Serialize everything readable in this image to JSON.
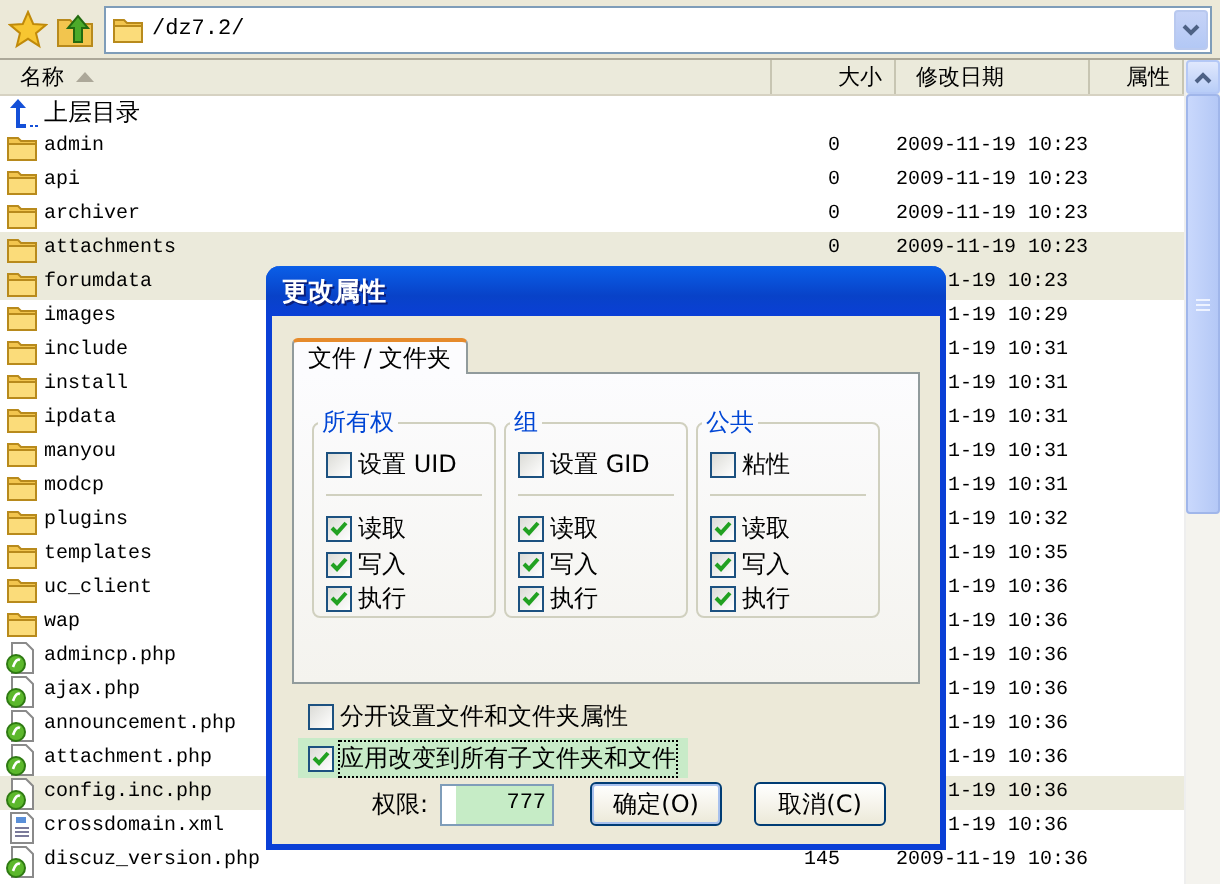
{
  "address": {
    "path": "/dz7.2/"
  },
  "columns": [
    {
      "label": "名称",
      "sorted": true
    },
    {
      "label": "大小",
      "sorted": false
    },
    {
      "label": "修改日期",
      "sorted": false
    },
    {
      "label": "属性",
      "sorted": false
    }
  ],
  "rows": [
    {
      "kind": "up",
      "name": "上层目录",
      "size": "",
      "date": "",
      "selected": false
    },
    {
      "kind": "folder",
      "name": "admin",
      "size": "0",
      "date": "2009-11-19 10:23",
      "selected": false
    },
    {
      "kind": "folder",
      "name": "api",
      "size": "0",
      "date": "2009-11-19 10:23",
      "selected": false
    },
    {
      "kind": "folder",
      "name": "archiver",
      "size": "0",
      "date": "2009-11-19 10:23",
      "selected": false
    },
    {
      "kind": "folder",
      "name": "attachments",
      "size": "0",
      "date": "2009-11-19 10:23",
      "selected": true
    },
    {
      "kind": "folder",
      "name": "forumdata",
      "size": "",
      "date": "1-19 10:23",
      "selected": true
    },
    {
      "kind": "folder",
      "name": "images",
      "size": "",
      "date": "1-19 10:29",
      "selected": false
    },
    {
      "kind": "folder",
      "name": "include",
      "size": "",
      "date": "1-19 10:31",
      "selected": false
    },
    {
      "kind": "folder",
      "name": "install",
      "size": "",
      "date": "1-19 10:31",
      "selected": false
    },
    {
      "kind": "folder",
      "name": "ipdata",
      "size": "",
      "date": "1-19 10:31",
      "selected": false
    },
    {
      "kind": "folder",
      "name": "manyou",
      "size": "",
      "date": "1-19 10:31",
      "selected": false
    },
    {
      "kind": "folder",
      "name": "modcp",
      "size": "",
      "date": "1-19 10:31",
      "selected": false
    },
    {
      "kind": "folder",
      "name": "plugins",
      "size": "",
      "date": "1-19 10:32",
      "selected": false
    },
    {
      "kind": "folder",
      "name": "templates",
      "size": "",
      "date": "1-19 10:35",
      "selected": false
    },
    {
      "kind": "folder",
      "name": "uc_client",
      "size": "",
      "date": "1-19 10:36",
      "selected": false
    },
    {
      "kind": "folder",
      "name": "wap",
      "size": "",
      "date": "1-19 10:36",
      "selected": false
    },
    {
      "kind": "php",
      "name": "admincp.php",
      "size": "",
      "date": "1-19 10:36",
      "selected": false
    },
    {
      "kind": "php",
      "name": "ajax.php",
      "size": "",
      "date": "1-19 10:36",
      "selected": false
    },
    {
      "kind": "php",
      "name": "announcement.php",
      "size": "",
      "date": "1-19 10:36",
      "selected": false
    },
    {
      "kind": "php",
      "name": "attachment.php",
      "size": "",
      "date": "1-19 10:36",
      "selected": false
    },
    {
      "kind": "php",
      "name": "config.inc.php",
      "size": "",
      "date": "1-19 10:36",
      "selected": true
    },
    {
      "kind": "xml",
      "name": "crossdomain.xml",
      "size": "",
      "date": "1-19 10:36",
      "selected": false
    },
    {
      "kind": "php",
      "name": "discuz_version.php",
      "size": "145",
      "date": "2009-11-19 10:36",
      "selected": false
    }
  ],
  "dialog": {
    "title": "更改属性",
    "tab": {
      "label": "文件 / 文件夹",
      "selected": true
    },
    "groups": [
      {
        "title": "所有权",
        "special": {
          "label": "设置 UID",
          "checked": false
        },
        "perms": [
          {
            "label": "读取",
            "checked": true
          },
          {
            "label": "写入",
            "checked": true
          },
          {
            "label": "执行",
            "checked": true
          }
        ]
      },
      {
        "title": "组",
        "special": {
          "label": "设置 GID",
          "checked": false
        },
        "perms": [
          {
            "label": "读取",
            "checked": true
          },
          {
            "label": "写入",
            "checked": true
          },
          {
            "label": "执行",
            "checked": true
          }
        ]
      },
      {
        "title": "公共",
        "special": {
          "label": "粘性",
          "checked": false
        },
        "perms": [
          {
            "label": "读取",
            "checked": true
          },
          {
            "label": "写入",
            "checked": true
          },
          {
            "label": "执行",
            "checked": true
          }
        ]
      }
    ],
    "options": [
      {
        "label": "分开设置文件和文件夹属性",
        "checked": false,
        "focused": false
      },
      {
        "label": "应用改变到所有子文件夹和文件",
        "checked": true,
        "focused": true
      }
    ],
    "permission": {
      "label": "权限:",
      "value": "777"
    },
    "buttons": [
      "确定(O)",
      "取消(C)"
    ]
  }
}
